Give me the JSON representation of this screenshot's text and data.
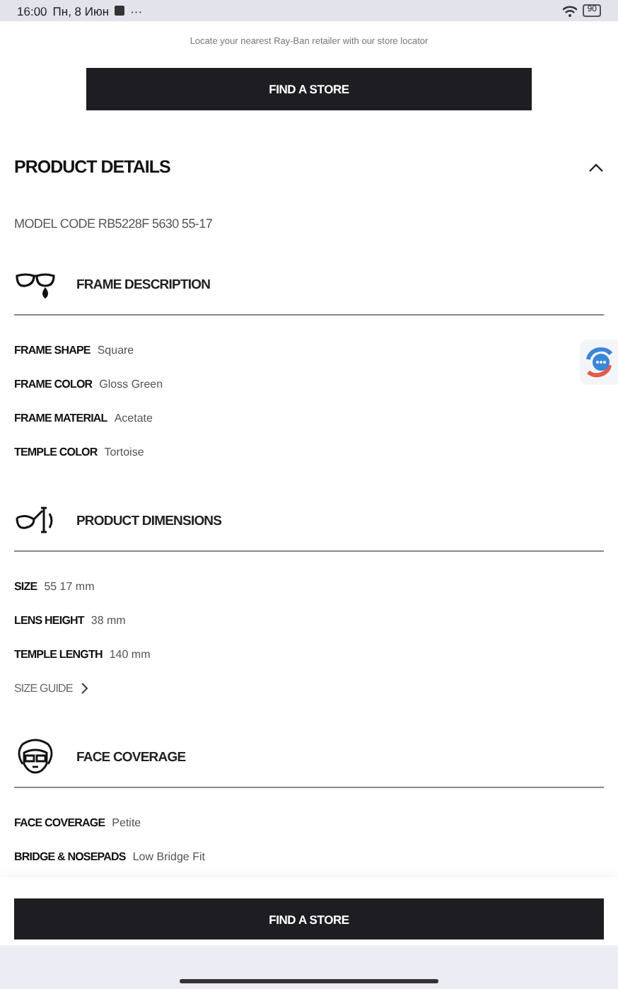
{
  "status_bar": {
    "time": "16:00",
    "date": "Пн, 8 Июн",
    "overflow": "···",
    "battery": "90"
  },
  "store_locator": {
    "text": "Locate your nearest Ray-Ban retailer with our store locator",
    "button": "FIND A STORE"
  },
  "product_details": {
    "title": "PRODUCT DETAILS",
    "expanded": true,
    "model_code": "MODEL CODE RB5228F 5630 55-17",
    "sections": [
      {
        "kind": "frame",
        "title": "FRAME DESCRIPTION",
        "rows": [
          {
            "label": "FRAME SHAPE",
            "value": "Square"
          },
          {
            "label": "FRAME COLOR",
            "value": "Gloss Green"
          },
          {
            "label": "FRAME MATERIAL",
            "value": "Acetate"
          },
          {
            "label": "TEMPLE COLOR",
            "value": "Tortoise"
          }
        ]
      },
      {
        "kind": "dimensions",
        "title": "PRODUCT DIMENSIONS",
        "rows": [
          {
            "label": "SIZE",
            "value": "55 17 mm"
          },
          {
            "label": "LENS HEIGHT",
            "value": "38 mm"
          },
          {
            "label": "TEMPLE LENGTH",
            "value": "140 mm"
          }
        ],
        "link": "SIZE GUIDE"
      },
      {
        "kind": "face",
        "title": "FACE COVERAGE",
        "rows": [
          {
            "label": "FACE COVERAGE",
            "value": "Petite"
          },
          {
            "label": "BRIDGE & NOSEPADS",
            "value": "Low Bridge Fit"
          }
        ]
      }
    ]
  },
  "bottom_button": "FIND A STORE"
}
